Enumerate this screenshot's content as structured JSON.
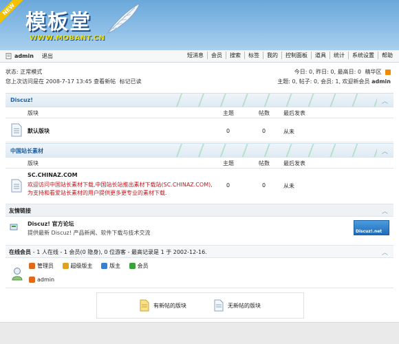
{
  "header": {
    "badge": "NEW",
    "logo_cn": "模板堂",
    "logo_en": "WWW.MOBANT.CN"
  },
  "userbar": {
    "username": "admin",
    "logout": "退出",
    "nav": [
      "短消息",
      "会员",
      "搜索",
      "标签",
      "我的",
      "控制面板",
      "道具",
      "统计",
      "系统设置",
      "帮助"
    ]
  },
  "status": {
    "line1": "状态: 正常模式",
    "line2_prefix": "您上次访问是在",
    "line2_time": "2008-7-17 13:45",
    "line2_new": "查看新帖",
    "line2_mark": "标记已读",
    "right1": "今日: 0, 昨日: 0, 最高日: 0",
    "right1_style": "精华区",
    "right2_prefix": "主题: 0, 帖子: 0, 会员: 1, 欢迎新会员",
    "right2_user": "admin"
  },
  "columns": {
    "forum": "版块",
    "topics": "主题",
    "posts": "帖数",
    "last": "最后发表"
  },
  "section1": {
    "title": "Discuz!",
    "forum_name": "默认版块",
    "topics": "0",
    "posts": "0",
    "last": "从未"
  },
  "section2": {
    "title": "中国站长素材",
    "forum_name": "SC.CHINAZ.COM",
    "desc1": "欢迎访问中国站长素材下载,中国站长站推出素材下载站(SC.CHINAZ.COM),",
    "desc2": "为支持和看爱站长素材的用户提供更多更专业的素材下载.",
    "topics": "0",
    "posts": "0",
    "last": "从未"
  },
  "links": {
    "title": "友情链接",
    "name": "Discuz! 官方论坛",
    "desc": "提供最新 Discuz! 产品新闻、软件下载与技术交流",
    "logo_text": "Discuz!.net"
  },
  "online": {
    "title": "在线会员",
    "summary": "- 1 人在线 - 1 会员(0 隐身), 0 位游客 - 最高记录是 1 于 2002-12-16.",
    "legend": [
      "管理员",
      "超级版主",
      "版主",
      "会员"
    ],
    "legend_colors": [
      "#e06a1a",
      "#e08a1a",
      "#3a7fd0",
      "#3aa23a"
    ],
    "users": [
      "admin"
    ]
  },
  "legend": {
    "new_posts": "有新帖的版块",
    "no_new_posts": "无新帖的版块"
  }
}
